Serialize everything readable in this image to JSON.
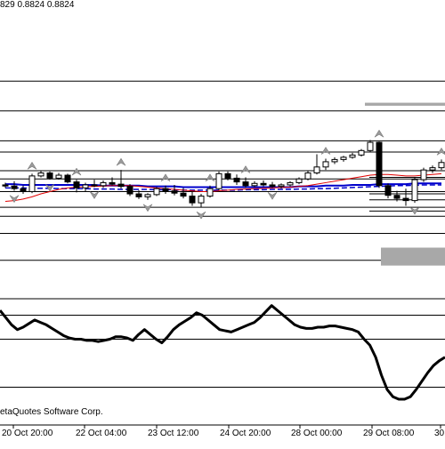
{
  "header": {
    "ohlc_text": "829 0.8824 0.8824"
  },
  "footer": {
    "credit": "etaQuotes Software Corp."
  },
  "x_axis": {
    "labels": [
      "20 Oct 20:00",
      "22 Oct 04:00",
      "23 Oct 12:00",
      "24 Oct 20:00",
      "28 Oct 00:00",
      "29 Oct 08:00",
      "30"
    ]
  },
  "colors": {
    "background": "#ffffff",
    "grid": "#000000",
    "bull_candle": "#ffffff",
    "bear_candle": "#000000",
    "ma_red": "#e00000",
    "ma_blue": "#0000cc",
    "zone_gray": "#a8a8a8"
  },
  "icons": [
    "fractal-up-icon",
    "fractal-down-icon"
  ],
  "chart_data": {
    "type": "line",
    "subtype": "candlestick-with-oscillator",
    "title": "",
    "xlabel": "",
    "ylabel": "",
    "grid": true,
    "main_panel": {
      "candles": [
        {
          "o": 0.6,
          "h": 0.9,
          "l": 0.2,
          "c": 0.45
        },
        {
          "o": 0.45,
          "h": 1.1,
          "l": -0.2,
          "c": 0.1
        },
        {
          "o": 0.1,
          "h": 0.5,
          "l": -0.6,
          "c": -0.3
        },
        {
          "o": -0.3,
          "h": 2.1,
          "l": -0.5,
          "c": 1.8
        },
        {
          "o": 1.8,
          "h": 2.5,
          "l": 1.6,
          "c": 2.2
        },
        {
          "o": 2.2,
          "h": 2.4,
          "l": 1.3,
          "c": 1.5
        },
        {
          "o": 1.5,
          "h": 2.2,
          "l": 1.3,
          "c": 1.9
        },
        {
          "o": 1.9,
          "h": 2.1,
          "l": 0.8,
          "c": 1.0
        },
        {
          "o": 1.0,
          "h": 1.3,
          "l": -0.4,
          "c": 0.2
        },
        {
          "o": 0.2,
          "h": 0.9,
          "l": -0.3,
          "c": 0.6
        },
        {
          "o": 0.6,
          "h": 1.3,
          "l": 0.3,
          "c": 0.5
        },
        {
          "o": 0.5,
          "h": 1.2,
          "l": 0.2,
          "c": 0.9
        },
        {
          "o": 0.9,
          "h": 1.6,
          "l": 0.5,
          "c": 0.7
        },
        {
          "o": 0.7,
          "h": 2.6,
          "l": 0.1,
          "c": 0.4
        },
        {
          "o": 0.4,
          "h": 0.7,
          "l": -0.9,
          "c": -0.6
        },
        {
          "o": -0.6,
          "h": -0.1,
          "l": -1.3,
          "c": -1.0
        },
        {
          "o": -1.0,
          "h": -0.5,
          "l": -1.4,
          "c": -0.7
        },
        {
          "o": -0.7,
          "h": 0.3,
          "l": -0.9,
          "c": 0.1
        },
        {
          "o": 0.1,
          "h": 0.5,
          "l": -0.6,
          "c": -0.2
        },
        {
          "o": -0.2,
          "h": 0.6,
          "l": -0.8,
          "c": -0.5
        },
        {
          "o": -0.5,
          "h": 0.2,
          "l": -1.2,
          "c": -0.9
        },
        {
          "o": -0.9,
          "h": -0.3,
          "l": -2.2,
          "c": -1.8
        },
        {
          "o": -1.8,
          "h": -0.6,
          "l": -2.4,
          "c": -0.9
        },
        {
          "o": -0.9,
          "h": 0.5,
          "l": -1.1,
          "c": 0.1
        },
        {
          "o": 0.1,
          "h": 2.4,
          "l": -0.1,
          "c": 2.1
        },
        {
          "o": 2.1,
          "h": 2.4,
          "l": 1.2,
          "c": 1.5
        },
        {
          "o": 1.5,
          "h": 2.0,
          "l": 0.6,
          "c": 1.0
        },
        {
          "o": 1.0,
          "h": 1.6,
          "l": 0.2,
          "c": 0.5
        },
        {
          "o": 0.5,
          "h": 1.1,
          "l": 0.3,
          "c": 0.8
        },
        {
          "o": 0.8,
          "h": 1.2,
          "l": 0.4,
          "c": 0.6
        },
        {
          "o": 0.6,
          "h": 1.0,
          "l": 0.2,
          "c": 0.4
        },
        {
          "o": 0.4,
          "h": 0.8,
          "l": 0.1,
          "c": 0.6
        },
        {
          "o": 0.6,
          "h": 1.1,
          "l": 0.4,
          "c": 0.9
        },
        {
          "o": 0.9,
          "h": 1.6,
          "l": 0.7,
          "c": 1.4
        },
        {
          "o": 1.4,
          "h": 2.5,
          "l": 1.2,
          "c": 2.2
        },
        {
          "o": 2.2,
          "h": 4.7,
          "l": 2.0,
          "c": 3.0
        },
        {
          "o": 3.0,
          "h": 4.1,
          "l": 2.6,
          "c": 3.7
        },
        {
          "o": 3.7,
          "h": 4.3,
          "l": 3.4,
          "c": 4.0
        },
        {
          "o": 4.0,
          "h": 4.5,
          "l": 3.7,
          "c": 4.3
        },
        {
          "o": 4.3,
          "h": 4.9,
          "l": 4.1,
          "c": 4.6
        },
        {
          "o": 4.6,
          "h": 5.4,
          "l": 4.4,
          "c": 5.2
        },
        {
          "o": 5.2,
          "h": 6.6,
          "l": 5.0,
          "c": 6.3
        },
        {
          "o": 6.3,
          "h": 6.4,
          "l": 0.2,
          "c": 0.5
        },
        {
          "o": 0.5,
          "h": 0.8,
          "l": -1.2,
          "c": -0.8
        },
        {
          "o": -0.8,
          "h": -0.2,
          "l": -1.6,
          "c": -1.2
        },
        {
          "o": -1.2,
          "h": 0.1,
          "l": -2.2,
          "c": -1.5
        },
        {
          "o": -1.5,
          "h": 1.6,
          "l": -1.8,
          "c": 1.3
        },
        {
          "o": 1.3,
          "h": 2.9,
          "l": 1.0,
          "c": 2.6
        },
        {
          "o": 2.6,
          "h": 3.2,
          "l": 2.2,
          "c": 2.9
        },
        {
          "o": 2.9,
          "h": 4.0,
          "l": 2.6,
          "c": 3.6
        }
      ],
      "ma_red": [
        -1.6,
        -1.5,
        -1.3,
        -1.0,
        -0.6,
        -0.3,
        0.0,
        0.2,
        0.3,
        0.35,
        0.4,
        0.45,
        0.5,
        0.5,
        0.5,
        0.4,
        0.3,
        0.2,
        0.1,
        0.0,
        -0.1,
        -0.2,
        -0.3,
        -0.3,
        -0.2,
        -0.1,
        0.0,
        0.05,
        0.1,
        0.15,
        0.2,
        0.25,
        0.3,
        0.4,
        0.5,
        0.7,
        0.9,
        1.1,
        1.3,
        1.5,
        1.7,
        1.9,
        2.0,
        2.0,
        1.9,
        1.8,
        1.8,
        1.9,
        2.0,
        2.1
      ],
      "ma_blue": [
        0.7,
        0.7,
        0.6,
        0.6,
        0.6,
        0.6,
        0.6,
        0.6,
        0.6,
        0.6,
        0.6,
        0.5,
        0.5,
        0.5,
        0.5,
        0.5,
        0.4,
        0.4,
        0.4,
        0.4,
        0.3,
        0.3,
        0.3,
        0.3,
        0.3,
        0.3,
        0.3,
        0.3,
        0.3,
        0.3,
        0.3,
        0.3,
        0.3,
        0.4,
        0.4,
        0.4,
        0.5,
        0.5,
        0.5,
        0.6,
        0.6,
        0.6,
        0.7,
        0.7,
        0.7,
        0.7,
        0.8,
        0.8,
        0.8,
        0.8
      ],
      "ma_blue_dashed": [
        0.2,
        0.2,
        0.2,
        0.15,
        0.15,
        0.15,
        0.1,
        0.1,
        0.1,
        0.1,
        0.05,
        0.05,
        0.05,
        0.0,
        0.0,
        0.0,
        0.0,
        -0.05,
        -0.05,
        -0.05,
        -0.1,
        -0.1,
        -0.1,
        -0.1,
        -0.1,
        -0.1,
        -0.1,
        -0.05,
        -0.05,
        -0.05,
        0.0,
        0.0,
        0.0,
        0.05,
        0.05,
        0.1,
        0.1,
        0.15,
        0.2,
        0.25,
        0.3,
        0.35,
        0.4,
        0.45,
        0.5,
        0.5,
        0.55,
        0.6,
        0.6,
        0.6
      ],
      "fractals_up": [
        3,
        8,
        13,
        18,
        23,
        27,
        36,
        42,
        49
      ],
      "fractals_down": [
        1,
        5,
        10,
        16,
        22,
        30,
        46
      ],
      "levels": [
        14.5,
        10.5,
        6.5,
        5.0,
        2.5,
        1.4,
        -0.3,
        -2.4,
        -3.6,
        -5.9,
        -9.5
      ],
      "levels_short": [
        1.6,
        -0.6,
        -1.4,
        -2.9
      ],
      "zone_top": [
        11.6,
        11.2
      ],
      "zone_bottom": [
        -7.8,
        -10.2
      ]
    },
    "oscillator": {
      "values": [
        -6,
        -12,
        -18,
        -22,
        -20,
        -17,
        -14,
        -16,
        -18,
        -21,
        -24,
        -27,
        -29,
        -30,
        -30,
        -31,
        -31,
        -32,
        -31,
        -30,
        -28,
        -28,
        -29,
        -31,
        -26,
        -22,
        -26,
        -30,
        -33,
        -28,
        -22,
        -18,
        -15,
        -12,
        -8,
        -10,
        -14,
        -18,
        -22,
        -23,
        -24,
        -22,
        -20,
        -18,
        -16,
        -12,
        -7,
        -2,
        -6,
        -10,
        -14,
        -18,
        -20,
        -21,
        -21,
        -20,
        -20,
        -19,
        -19,
        -20,
        -21,
        -22,
        -24,
        -30,
        -35,
        -45,
        -60,
        -72,
        -78,
        -80,
        -80,
        -78,
        -72,
        -65,
        -58,
        -52,
        -48,
        -45
      ],
      "ylim": [
        -100,
        0
      ],
      "levels": [
        -10,
        -30,
        -70
      ]
    }
  }
}
